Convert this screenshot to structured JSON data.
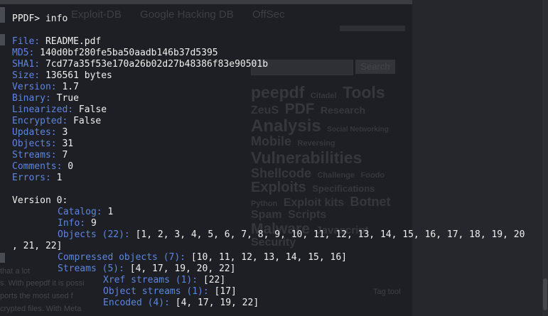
{
  "background_page": {
    "tabs": [
      "Exploit-DB",
      "Google Hacking DB",
      "OffSec"
    ],
    "search_button": "Search",
    "tag_cloud": [
      "peepdf",
      "Citadel",
      "Tools",
      "ZeuS",
      "PDF",
      "Research",
      "Analysis",
      "Social Networking",
      "Mobile",
      "Reversing",
      "Vulnerabilities",
      "Shellcode",
      "Challenge",
      "Foodo",
      "Exploits",
      "Specifications",
      "Python",
      "Exploit kits",
      "Botnet",
      "Spam",
      "Scripts",
      "Malware",
      "Javascript",
      "Security"
    ],
    "tag_tool_label": "Tag tool",
    "left_snippets": [
      "that a lot",
      "s. With peepdf it is possi",
      "ports the most used f",
      "crypted files. With Meta"
    ]
  },
  "terminal": {
    "prompt": "PPDF> ",
    "command": "info",
    "file": {
      "label": "File:",
      "value": "README.pdf"
    },
    "md5": {
      "label": "MD5:",
      "value": "140d0bf280fe5ba50aadb146b37d5395"
    },
    "sha1": {
      "label": "SHA1:",
      "value": "7cd77a35f53e170a26b02d27b48386f83e90501b"
    },
    "size": {
      "label": "Size:",
      "value": "136561 bytes"
    },
    "version": {
      "label": "Version:",
      "value": "1.7"
    },
    "binary": {
      "label": "Binary:",
      "value": "True"
    },
    "linearized": {
      "label": "Linearized:",
      "value": "False"
    },
    "encrypted": {
      "label": "Encrypted:",
      "value": "False"
    },
    "updates": {
      "label": "Updates:",
      "value": "3"
    },
    "objects": {
      "label": "Objects:",
      "value": "31"
    },
    "streams": {
      "label": "Streams:",
      "value": "7"
    },
    "comments": {
      "label": "Comments:",
      "value": "0"
    },
    "errors": {
      "label": "Errors:",
      "value": "1"
    },
    "version_section": {
      "label": "Version 0:"
    },
    "catalog": {
      "label": "Catalog:",
      "value": "1"
    },
    "info": {
      "label": "Info:",
      "value": "9"
    },
    "objects_list": {
      "label": "Objects (22):",
      "value": "[1, 2, 3, 4, 5, 6, 7, 8, 9, 10, 11, 12, 13, 14, 15, 16, 17, 18, 19, 20",
      "wrap": ", 21, 22]"
    },
    "compressed_objects": {
      "label": "Compressed objects (7):",
      "value": "[10, 11, 12, 13, 14, 15, 16]"
    },
    "streams_list": {
      "label": "Streams (5):",
      "value": "[4, 17, 19, 20, 22]"
    },
    "xref_streams": {
      "label": "Xref streams (1):",
      "value": "[22]"
    },
    "object_streams": {
      "label": "Object streams (1):",
      "value": "[17]"
    },
    "encoded": {
      "label": "Encoded (4):",
      "value": "[4, 17, 19, 22]"
    }
  },
  "colors": {
    "key": "#5b86e0",
    "value": "#f0f0f0",
    "background": "#1e1f24"
  }
}
